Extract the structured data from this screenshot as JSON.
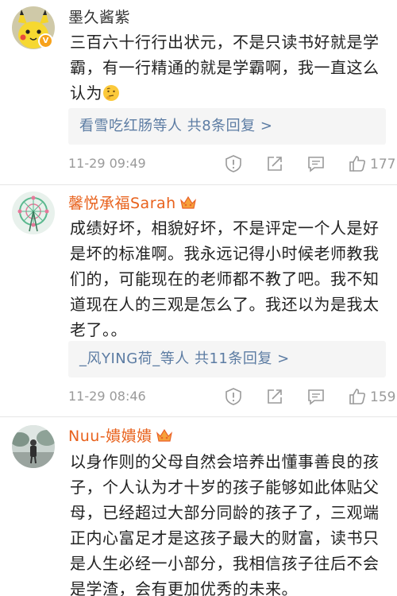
{
  "comments": [
    {
      "username": "墨久酱紫",
      "verified_badge": "V",
      "body": "三百六十行行出状元，不是只读书好就是学霸，有一行精通的就是学霸啊，我一直这么认为",
      "emoji_icon": "thinking-face-icon",
      "reply_summary": "看雪吃红肠等人  共8条回复 >",
      "time": "11-29 09:49",
      "likes": "177"
    },
    {
      "username": "馨悦承福Sarah",
      "vip_icon": "crown-icon",
      "body": "成绩好坏，相貌好坏，不是评定一个人是好是坏的标准啊。我永远记得小时候老师教我们的，可能现在的老师都不教了吧。我不知道现在人的三观是怎么了。我还以为是我太老了。。",
      "reply_summary": "_风YING荷_等人  共11条回复 >",
      "time": "11-29 08:46",
      "likes": "159"
    },
    {
      "username": "Nuu-嬇嬇嬇",
      "vip_icon": "crown-icon",
      "body": "以身作则的父母自然会培养出懂事善良的孩子，个人认为才十岁的孩子能够如此体贴父母，已经超过大部分同龄的孩子了，三观端正内心富足才是这孩子最大的财富，读书只是人生必经一小部分，我相信孩子往后不会是学渣，会有更加优秀的未来。"
    }
  ],
  "colors": {
    "vip_name": "#e8621d",
    "reply_link": "#5c7ca3",
    "meta_gray": "#9a9a9a",
    "verified_badge": "#f7a21b"
  },
  "action_icons": [
    "report-icon",
    "share-icon",
    "comment-icon",
    "like-thumb-icon"
  ]
}
